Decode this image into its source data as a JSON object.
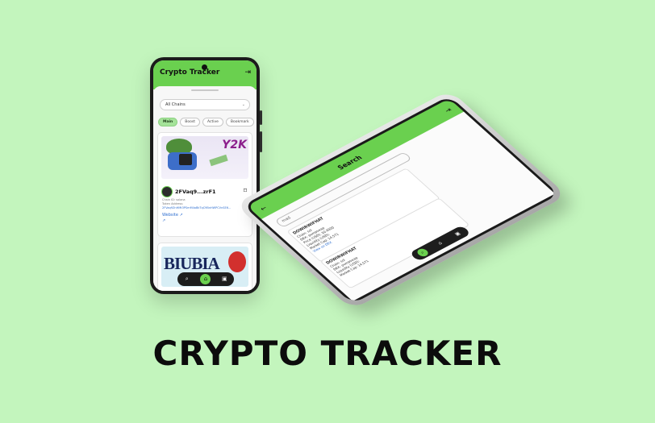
{
  "colors": {
    "background": "#c3f5bd",
    "accent": "#6ad04f",
    "chip_active": "#a5e39a",
    "link": "#2f6fd0"
  },
  "phone1": {
    "app_title": "Crypto Tracker",
    "logout_icon": "logout-icon",
    "chain_select": {
      "value": "All Chains"
    },
    "tabs": [
      {
        "label": "Main",
        "active": true
      },
      {
        "label": "Boost",
        "active": false
      },
      {
        "label": "Active",
        "active": false
      },
      {
        "label": "Bookmark",
        "active": false
      }
    ],
    "token_card": {
      "image_text": "Y2K",
      "name": "2FVaq9...zrF1",
      "chain_id": "Chain ID: solana",
      "token_address_label": "Token Address:",
      "token_address": "2FVaq9ZnHMt3PSmM4aBkTqC9BnHWPCVnSE6...",
      "website": "Website",
      "bookmark_icon": "bookmark-icon"
    },
    "token_card_2": {
      "image_text": "BIUBIA"
    },
    "navbar": [
      {
        "icon": "search-icon",
        "glyph": "⌕",
        "active": false
      },
      {
        "icon": "home-icon",
        "glyph": "⌂",
        "active": true
      },
      {
        "icon": "wallet-icon",
        "glyph": "▣",
        "active": false
      }
    ]
  },
  "phone2": {
    "app_title": "Search",
    "search_placeholder": "mad",
    "result1": {
      "name": "DOWIRWIFHAT",
      "chain": "Chain: sol",
      "dex": "DEX: pumpswap",
      "price_usd": "Price (USD): $0.0000",
      "price_native": "Price (Native): 0.0",
      "liquidity": "Liquidity (USD):",
      "fdv": "FDV: 14,571",
      "market_cap": "Market Cap: 14,571",
      "created": "Created At: 3 days",
      "view": "View on DEX"
    },
    "result2": {
      "name": "DOWIRWIFHAT",
      "chain": "Chain: sol",
      "dex": "DEX: pumpswap",
      "liquidity": "Liquidity (USD):",
      "fdv": "FDV: 14,571",
      "market_cap": "Market Cap: 14,571"
    },
    "navbar": [
      {
        "icon": "search-icon",
        "glyph": "⌕",
        "active": true
      },
      {
        "icon": "home-icon",
        "glyph": "⌂",
        "active": false
      },
      {
        "icon": "wallet-icon",
        "glyph": "▣",
        "active": false
      }
    ]
  },
  "headline": "CRYPTO TRACKER"
}
